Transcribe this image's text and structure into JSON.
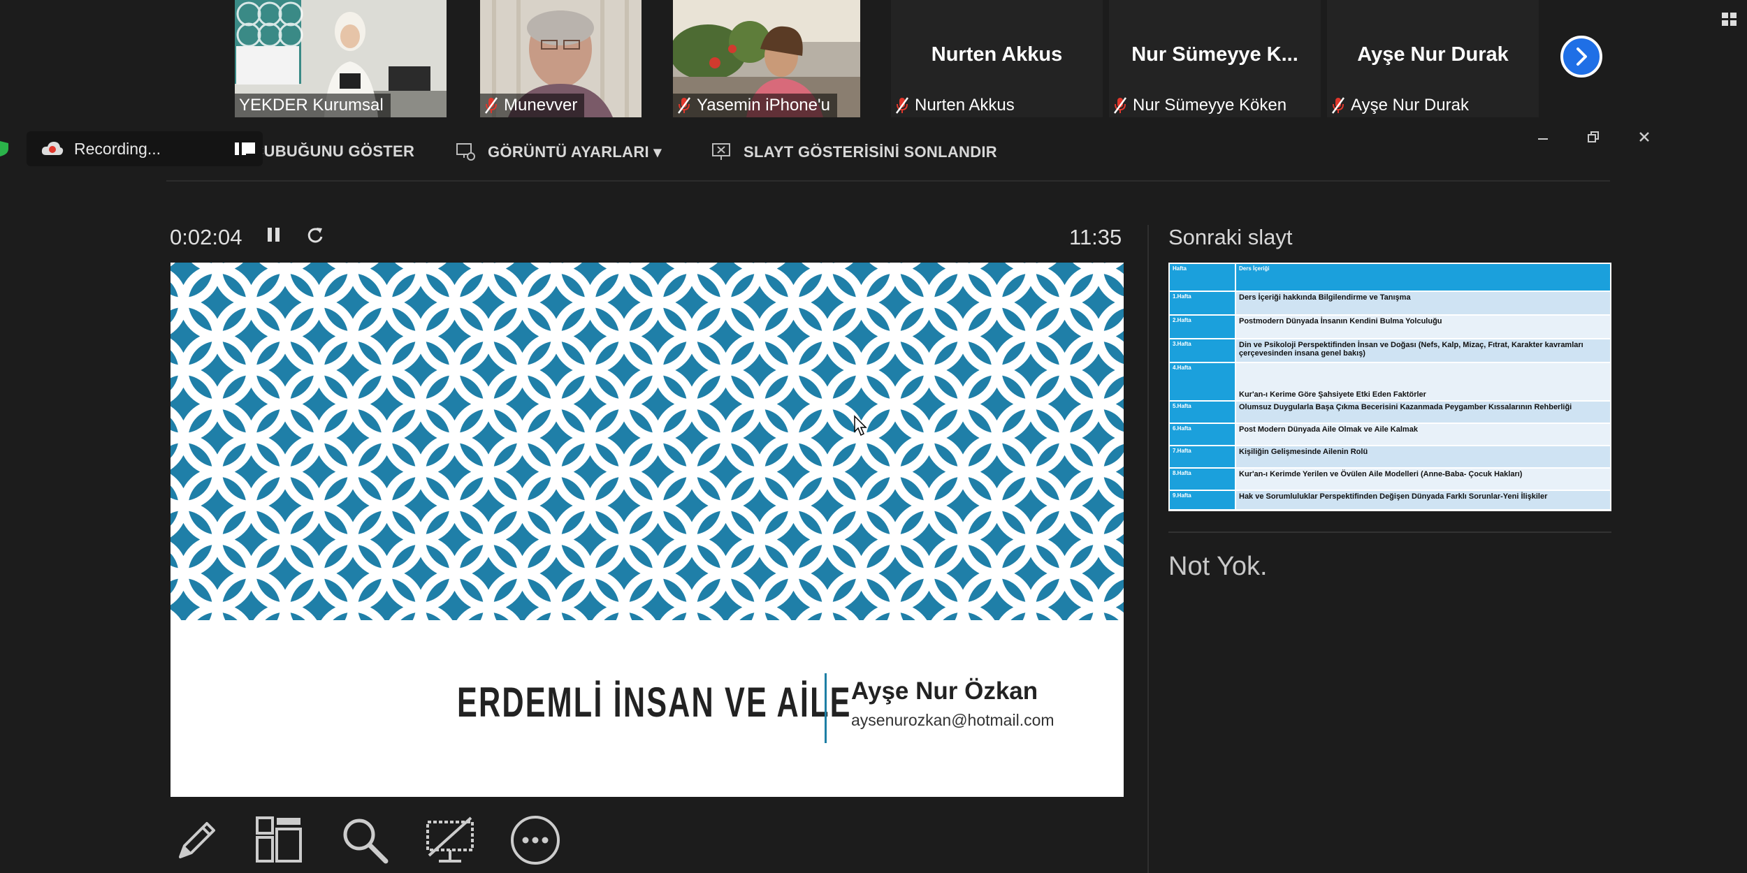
{
  "participants": [
    {
      "name": "YEKDER Kurumsal",
      "has_video": true,
      "muted": false,
      "active_speaker": true
    },
    {
      "name": "Munevver",
      "has_video": true,
      "muted": true,
      "active_speaker": false
    },
    {
      "name": "Yasemin iPhone'u",
      "has_video": true,
      "muted": true,
      "active_speaker": false
    },
    {
      "name": "Nurten Akkus",
      "display_name": "Nurten Akkus",
      "has_video": false,
      "muted": true
    },
    {
      "name": "Nur Sümeyye Köken",
      "display_name": "Nur Sümeyye K...",
      "has_video": false,
      "muted": true
    },
    {
      "name": "Ayşe Nur Durak",
      "display_name": "Ayşe Nur Durak",
      "has_video": false,
      "muted": true
    }
  ],
  "recording": {
    "label": "Recording..."
  },
  "toolbar": {
    "taskbar_label": "GÖREV ÇUBUĞUNU GÖSTER",
    "display_settings_label": "GÖRÜNTÜ AYARLARI ▾",
    "end_slideshow_label": "SLAYT GÖSTERİSİNİ SONLANDIR"
  },
  "presenter": {
    "elapsed": "0:02:04",
    "clock": "11:35",
    "next_slide_label": "Sonraki slayt",
    "notes": "Not Yok."
  },
  "slide": {
    "title": "ERDEMLİ İNSAN VE AİLE",
    "author": "Ayşe Nur Özkan",
    "email": "aysenurozkan@hotmail.com",
    "pattern_color": "#1f7fa8"
  },
  "next_slide": {
    "header": {
      "week": "Hafta",
      "content": "Ders İçeriği"
    },
    "rows": [
      {
        "week": "1.Hafta",
        "content": " Ders İçeriği hakkında Bilgilendirme ve Tanışma"
      },
      {
        "week": "2.Hafta",
        "content": "Postmodern Dünyada İnsanın Kendini Bulma Yolculuğu"
      },
      {
        "week": "3.Hafta",
        "content": "Din ve Psikoloji Perspektifinden İnsan ve Doğası (Nefs, Kalp, Mizaç, Fıtrat, Karakter kavramları çerçevesinden insana genel bakış)"
      },
      {
        "week": "4.Hafta",
        "content": "Kur'an-ı Kerime Göre Şahsiyete Etki Eden Faktörler"
      },
      {
        "week": "5.Hafta",
        "content": "Olumsuz Duygularla Başa Çıkma Becerisini Kazanmada Peygamber Kıssalarının Rehberliği"
      },
      {
        "week": "6.Hafta",
        "content": "Post Modern Dünyada Aile Olmak ve Aile Kalmak"
      },
      {
        "week": "7.Hafta",
        "content": "Kişiliğin Gelişmesinde Ailenin Rolü"
      },
      {
        "week": "8.Hafta",
        "content": "Kur'an-ı Kerimde Yerilen ve Övülen Aile Modelleri (Anne-Baba- Çocuk Hakları)"
      },
      {
        "week": "9.Hafta",
        "content": "Hak ve Sorumluluklar Perspektifinden Değişen Dünyada Farklı Sorunlar-Yeni İlişkiler"
      }
    ]
  },
  "bottom_tools": [
    "pen-icon",
    "grid-icon",
    "zoom-icon",
    "screen-off-icon",
    "more-icon"
  ],
  "colors": {
    "accent_blue": "#1f6fe6",
    "active_border": "#7dc13f",
    "muted_red": "#e0372c"
  }
}
